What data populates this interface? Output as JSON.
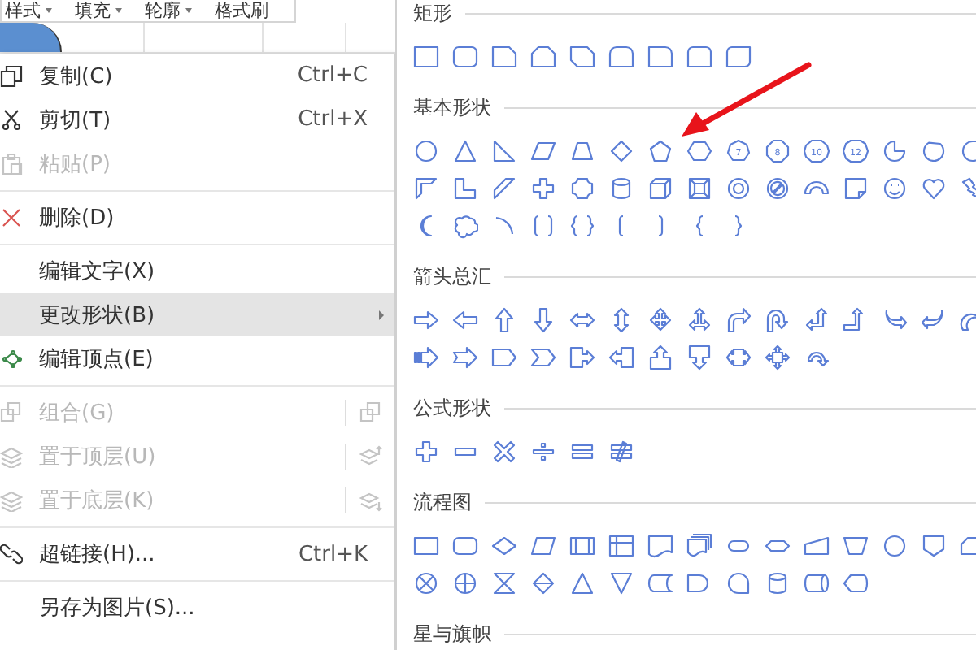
{
  "toolbar": [
    {
      "label": "样式",
      "dropdown": true
    },
    {
      "label": "填充",
      "dropdown": true
    },
    {
      "label": "轮廓",
      "dropdown": true
    },
    {
      "label": "格式刷",
      "dropdown": false
    }
  ],
  "context_menu": [
    {
      "label": "复制(C)",
      "shortcut": "Ctrl+C",
      "kind": "copy",
      "disabled": false,
      "selected": false,
      "separator_above": false,
      "submenu": false
    },
    {
      "label": "剪切(T)",
      "shortcut": "Ctrl+X",
      "kind": "cut",
      "disabled": false,
      "selected": false,
      "separator_above": false,
      "submenu": false
    },
    {
      "label": "粘贴(P)",
      "kind": "paste",
      "disabled": true,
      "selected": false,
      "separator_above": false,
      "submenu": false
    },
    {
      "label": "删除(D)",
      "kind": "delete",
      "disabled": false,
      "selected": false,
      "separator_above": true,
      "submenu": false
    },
    {
      "label": "编辑文字(X)",
      "kind": "plain",
      "disabled": false,
      "selected": false,
      "separator_above": true,
      "submenu": false
    },
    {
      "label": "更改形状(B)",
      "kind": "plain",
      "disabled": false,
      "selected": true,
      "separator_above": false,
      "submenu": true
    },
    {
      "label": "编辑顶点(E)",
      "kind": "vertex",
      "disabled": false,
      "selected": false,
      "separator_above": false,
      "submenu": false
    },
    {
      "label": "组合(G)",
      "kind": "group",
      "disabled": true,
      "selected": false,
      "separator_above": true,
      "submenu": false
    },
    {
      "label": "置于顶层(U)",
      "kind": "bring-front",
      "disabled": true,
      "selected": false,
      "separator_above": false,
      "submenu": false
    },
    {
      "label": "置于底层(K)",
      "kind": "send-back",
      "disabled": true,
      "selected": false,
      "separator_above": false,
      "submenu": false
    },
    {
      "label": "超链接(H)...",
      "shortcut": "Ctrl+K",
      "kind": "link",
      "disabled": false,
      "selected": false,
      "separator_above": true,
      "submenu": false
    },
    {
      "label": "另存为图片(S)...",
      "kind": "plain",
      "disabled": false,
      "selected": false,
      "separator_above": true,
      "submenu": false
    }
  ],
  "shape_gallery": [
    {
      "title": "矩形",
      "rows": [
        [
          {
            "kind": "rectangle"
          },
          {
            "kind": "rounded-rectangle"
          },
          {
            "kind": "snip-corner"
          },
          {
            "kind": "snip-two-corners"
          },
          {
            "kind": "snip-diagonal"
          },
          {
            "kind": "round-top"
          },
          {
            "kind": "round-corner"
          },
          {
            "kind": "round-two-corners"
          },
          {
            "kind": "round-diagonal"
          }
        ]
      ]
    },
    {
      "title": "基本形状",
      "rows": [
        [
          {
            "kind": "ellipse"
          },
          {
            "kind": "triangle"
          },
          {
            "kind": "right-triangle"
          },
          {
            "kind": "parallelogram"
          },
          {
            "kind": "trapezoid"
          },
          {
            "kind": "diamond"
          },
          {
            "kind": "pentagon"
          },
          {
            "kind": "hexagon"
          },
          {
            "kind": "heptagon",
            "label": "7"
          },
          {
            "kind": "octagon",
            "label": "8"
          },
          {
            "kind": "decagon",
            "label": "10"
          },
          {
            "kind": "dodecagon",
            "label": "12"
          },
          {
            "kind": "pie"
          },
          {
            "kind": "chord"
          },
          {
            "kind": "teardrop"
          }
        ],
        [
          {
            "kind": "half-frame"
          },
          {
            "kind": "l-shape"
          },
          {
            "kind": "diagonal-stripe"
          },
          {
            "kind": "cross"
          },
          {
            "kind": "plaque"
          },
          {
            "kind": "cylinder"
          },
          {
            "kind": "cube"
          },
          {
            "kind": "bevel"
          },
          {
            "kind": "donut"
          },
          {
            "kind": "no-symbol"
          },
          {
            "kind": "block-arc"
          },
          {
            "kind": "folded-corner"
          },
          {
            "kind": "smiley"
          },
          {
            "kind": "heart"
          },
          {
            "kind": "lightning"
          }
        ],
        [
          {
            "kind": "moon"
          },
          {
            "kind": "cloud"
          },
          {
            "kind": "arc"
          },
          {
            "kind": "double-bracket"
          },
          {
            "kind": "double-brace"
          },
          {
            "kind": "left-bracket"
          },
          {
            "kind": "right-bracket"
          },
          {
            "kind": "left-brace"
          },
          {
            "kind": "right-brace"
          }
        ]
      ]
    },
    {
      "title": "箭头总汇",
      "rows": [
        [
          {
            "kind": "right-arrow"
          },
          {
            "kind": "left-arrow"
          },
          {
            "kind": "up-arrow"
          },
          {
            "kind": "down-arrow"
          },
          {
            "kind": "left-right-arrow"
          },
          {
            "kind": "up-down-arrow"
          },
          {
            "kind": "quad-arrow"
          },
          {
            "kind": "left-right-up-arrow"
          },
          {
            "kind": "bent-arrow"
          },
          {
            "kind": "u-turn-arrow"
          },
          {
            "kind": "left-up-arrow"
          },
          {
            "kind": "bent-up-arrow"
          },
          {
            "kind": "curved-right-arrow"
          },
          {
            "kind": "curved-left-arrow"
          },
          {
            "kind": "curved-up-arrow"
          }
        ],
        [
          {
            "kind": "striped-right-arrow"
          },
          {
            "kind": "notched-right-arrow"
          },
          {
            "kind": "pentagon-arrow"
          },
          {
            "kind": "chevron"
          },
          {
            "kind": "right-callout-arrow"
          },
          {
            "kind": "left-callout-arrow"
          },
          {
            "kind": "up-callout-arrow"
          },
          {
            "kind": "down-callout-arrow"
          },
          {
            "kind": "left-right-callout-arrow"
          },
          {
            "kind": "quad-callout-arrow"
          },
          {
            "kind": "circular-arrow"
          }
        ]
      ]
    },
    {
      "title": "公式形状",
      "rows": [
        [
          {
            "kind": "plus"
          },
          {
            "kind": "minus"
          },
          {
            "kind": "multiply"
          },
          {
            "kind": "divide"
          },
          {
            "kind": "equal"
          },
          {
            "kind": "not-equal"
          }
        ]
      ]
    },
    {
      "title": "流程图",
      "rows": [
        [
          {
            "kind": "process"
          },
          {
            "kind": "alternate-process"
          },
          {
            "kind": "decision"
          },
          {
            "kind": "data"
          },
          {
            "kind": "predefined-process"
          },
          {
            "kind": "internal-storage"
          },
          {
            "kind": "document"
          },
          {
            "kind": "multidocument"
          },
          {
            "kind": "terminator"
          },
          {
            "kind": "preparation"
          },
          {
            "kind": "manual-input"
          },
          {
            "kind": "manual-operation"
          },
          {
            "kind": "connector"
          },
          {
            "kind": "off-page-connector"
          },
          {
            "kind": "card"
          }
        ],
        [
          {
            "kind": "summing-junction"
          },
          {
            "kind": "or"
          },
          {
            "kind": "collate"
          },
          {
            "kind": "sort"
          },
          {
            "kind": "extract"
          },
          {
            "kind": "merge"
          },
          {
            "kind": "stored-data"
          },
          {
            "kind": "delay"
          },
          {
            "kind": "sequential-access"
          },
          {
            "kind": "magnetic-disk"
          },
          {
            "kind": "direct-access"
          },
          {
            "kind": "display"
          }
        ]
      ]
    },
    {
      "title": "星与旗帜"
    }
  ]
}
